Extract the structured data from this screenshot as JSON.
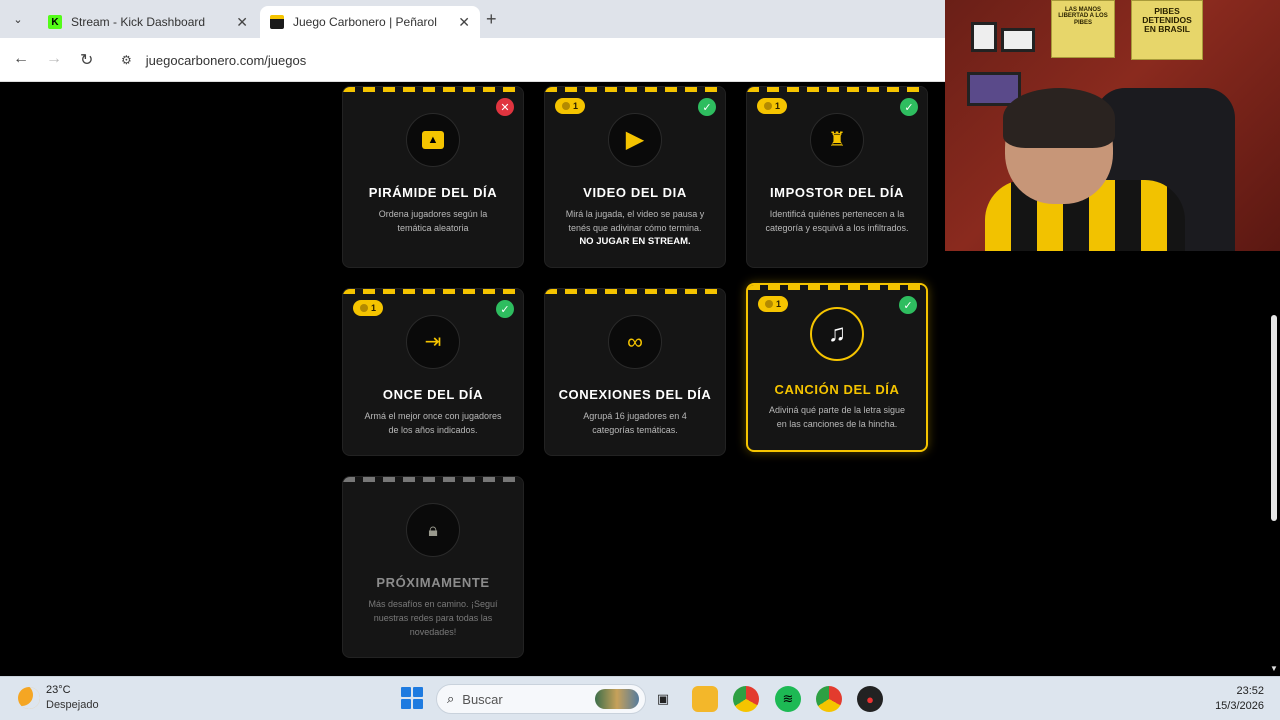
{
  "browser": {
    "tabs": [
      {
        "title": "Stream - Kick Dashboard",
        "active": false
      },
      {
        "title": "Juego Carbonero | Peñarol",
        "active": true
      }
    ],
    "url": "juegocarbonero.com/juegos"
  },
  "cards": [
    {
      "title": "PIRÁMIDE DEL DÍA",
      "desc": "Ordena jugadores según la temática aleatoria",
      "status": "fail",
      "icon": "pyramid-icon"
    },
    {
      "title": "VIDEO DEL DIA",
      "desc": "Mirá la jugada, el video se pausa y tenés que adivinar cómo termina.",
      "warning": "NO JUGAR EN STREAM.",
      "coins": "1",
      "status": "ok",
      "icon": "play-icon"
    },
    {
      "title": "IMPOSTOR DEL DÍA",
      "desc": "Identificá quiénes pertenecen a la categoría y esquivá a los infiltrados.",
      "coins": "1",
      "status": "ok",
      "icon": "impostor-icon"
    },
    {
      "title": "ONCE DEL DÍA",
      "desc": "Armá el mejor once con jugadores de los años indicados.",
      "coins": "1",
      "status": "ok",
      "icon": "lineup-icon"
    },
    {
      "title": "CONEXIONES DEL DÍA",
      "desc": "Agrupá 16 jugadores en 4 categorías temáticas.",
      "icon": "link-icon"
    },
    {
      "title": "CANCIÓN DEL DÍA",
      "desc": "Adiviná qué parte de la letra sigue en las canciones de la hincha.",
      "coins": "1",
      "status": "ok",
      "icon": "music-icon"
    },
    {
      "title": "PRÓXIMAMENTE",
      "desc": "Más desafíos en camino. ¡Seguí nuestras redes para todas las novedades!",
      "icon": "lock-icon"
    }
  ],
  "webcam": {
    "posters": [
      "LAS MANOS LIBERTAD A LOS PIBES",
      "PIBES DETENIDOS EN BRASIL"
    ]
  },
  "taskbar": {
    "temperature": "23°C",
    "condition": "Despejado",
    "search_placeholder": "Buscar",
    "time": "23:52",
    "date": "15/3/2026"
  },
  "colors": {
    "accent": "#f5c400",
    "success": "#2ebd5f",
    "danger": "#e0343f",
    "card_bg": "#151515"
  }
}
